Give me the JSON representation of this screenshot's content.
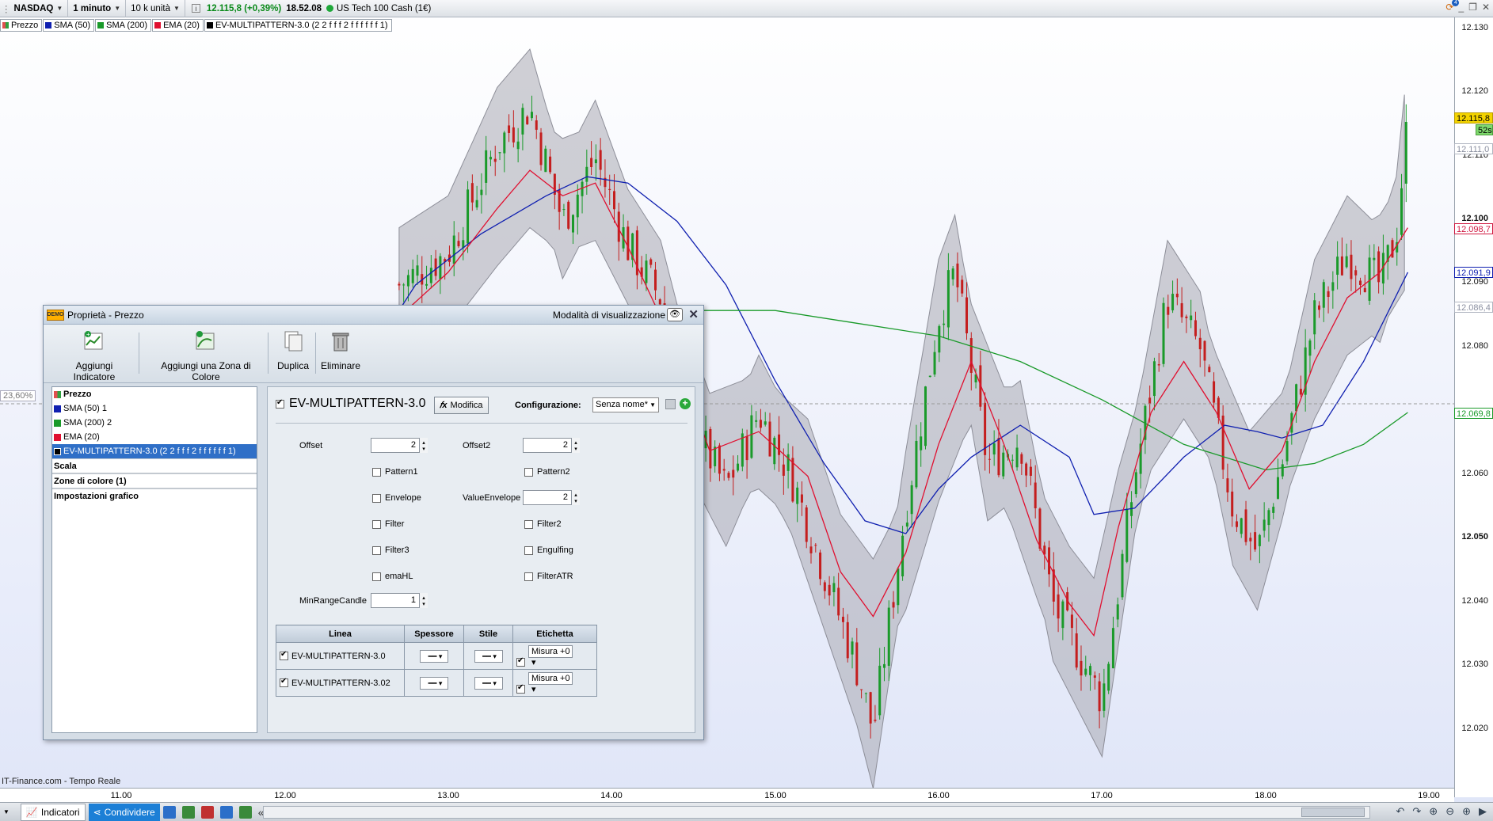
{
  "topbar": {
    "market": "NASDAQ",
    "interval": "1 minuto",
    "units": "10 k unità",
    "info_icon": "info-icon",
    "price_change": "12.115,8 (+0,39%)",
    "time": "18.52.08",
    "instrument": "US Tech 100 Cash (1€)",
    "notification_count": "4"
  },
  "legend": [
    {
      "label": "Prezzo",
      "color": "#e0505a"
    },
    {
      "label": "SMA (50)",
      "color": "#1020b0"
    },
    {
      "label": "SMA (200)",
      "color": "#1a9a2a"
    },
    {
      "label": "EMA (20)",
      "color": "#e01030"
    },
    {
      "label": "EV-MULTIPATTERN-3.0 (2 2 f f f 2 f f f f f f 1)",
      "color": "#000000"
    }
  ],
  "chart_data": {
    "type": "line",
    "title": "",
    "instrument": "US Tech 100 Cash (1€)",
    "ylim": [
      12015,
      12132
    ],
    "y_ticks": [
      "12.130",
      "12.120",
      "12.110",
      "12.100",
      "12.090",
      "12.080",
      "12.070",
      "12.060",
      "12.050",
      "12.040",
      "12.030",
      "12.020"
    ],
    "x_ticks": [
      "11.00",
      "12.00",
      "13.00",
      "14.00",
      "15.00",
      "16.00",
      "17.00",
      "18.00",
      "19.00"
    ],
    "series": [
      {
        "name": "SMA (50)",
        "color": "#1020b0",
        "x": [
          12.55,
          12.8,
          13.2,
          13.6,
          13.85,
          14.1,
          14.4,
          14.7,
          15.0,
          15.3,
          15.55,
          15.8,
          16.0,
          16.2,
          16.5,
          16.8,
          16.95,
          17.2,
          17.5,
          17.75,
          17.95,
          18.1,
          18.35,
          18.6,
          18.87
        ],
        "y": [
          12080,
          12090,
          12098,
          12104,
          12107,
          12106,
          12100,
          12090,
          12075,
          12062,
          12053,
          12051,
          12058,
          12063,
          12068,
          12063,
          12054,
          12055,
          12063,
          12068,
          12067,
          12066,
          12068,
          12078,
          12092
        ]
      },
      {
        "name": "SMA (200)",
        "color": "#1a9a2a",
        "x": [
          14.5,
          15.0,
          15.5,
          16.0,
          16.5,
          17.0,
          17.5,
          18.0,
          18.3,
          18.6,
          18.87
        ],
        "y": [
          12086,
          12086,
          12084,
          12082,
          12078,
          12072,
          12065,
          12061,
          12062,
          12065,
          12070
        ]
      },
      {
        "name": "EMA (20)",
        "color": "#e01030",
        "x": [
          12.7,
          13.0,
          13.3,
          13.5,
          13.7,
          13.9,
          14.1,
          14.3,
          14.6,
          14.9,
          15.2,
          15.4,
          15.6,
          15.8,
          16.0,
          16.2,
          16.4,
          16.6,
          16.8,
          16.95,
          17.1,
          17.3,
          17.5,
          17.7,
          17.9,
          18.1,
          18.3,
          18.5,
          18.7,
          18.87
        ],
        "y": [
          12085,
          12092,
          12102,
          12108,
          12104,
          12106,
          12096,
          12085,
          12064,
          12067,
          12060,
          12045,
          12038,
          12048,
          12065,
          12078,
          12065,
          12050,
          12040,
          12035,
          12052,
          12070,
          12078,
          12070,
          12058,
          12064,
          12078,
          12088,
          12092,
          12099
        ]
      },
      {
        "name": "Prezzo",
        "color": "#1a9a2a",
        "x": [
          12.7,
          13.0,
          13.3,
          13.5,
          13.7,
          13.9,
          14.1,
          14.3,
          14.5,
          14.7,
          14.9,
          15.1,
          15.3,
          15.5,
          15.6,
          15.8,
          16.0,
          16.1,
          16.3,
          16.5,
          16.7,
          16.9,
          17.0,
          17.2,
          17.4,
          17.6,
          17.8,
          17.95,
          18.1,
          18.3,
          18.5,
          18.7,
          18.8,
          18.87
        ],
        "y": [
          12090,
          12095,
          12112,
          12118,
          12100,
          12110,
          12096,
          12088,
          12068,
          12058,
          12070,
          12060,
          12045,
          12030,
          12020,
          12055,
          12085,
          12092,
          12062,
          12066,
          12040,
          12030,
          12025,
          12060,
          12088,
          12080,
          12055,
          12048,
          12062,
          12085,
          12095,
          12090,
          12098,
          12116
        ]
      }
    ],
    "envelope": {
      "label": "EV-MULTIPATTERN-3.0",
      "color": "#9a9aa3"
    }
  },
  "price_axis": {
    "labels": [
      {
        "text": "12.130",
        "bold": false
      },
      {
        "text": "12.120",
        "bold": false
      },
      {
        "text": "12.110",
        "bold": false
      },
      {
        "text": "12.100",
        "bold": true
      },
      {
        "text": "12.090",
        "bold": false
      },
      {
        "text": "12.080",
        "bold": false
      },
      {
        "text": "12.060",
        "bold": false
      },
      {
        "text": "12.050",
        "bold": true
      },
      {
        "text": "12.040",
        "bold": false
      },
      {
        "text": "12.030",
        "bold": false
      },
      {
        "text": "12.020",
        "bold": false
      }
    ],
    "tags": {
      "current": "12.115,8",
      "countdown": "52s",
      "t1": "12.111,0",
      "t2": "12.098,7",
      "t3": "12.091,9",
      "t4": "12.086,4",
      "t5": "12.069,8"
    },
    "fib": "23,60%"
  },
  "watermark": "IT-Finance.com - Tempo Reale",
  "time_axis": [
    "11.00",
    "12.00",
    "13.00",
    "14.00",
    "15.00",
    "16.00",
    "17.00",
    "18.00",
    "19.00"
  ],
  "bottombar": {
    "indicators": "Indicatori",
    "share": "Condividere"
  },
  "dialog": {
    "badge": "DEMO",
    "title": "Proprietà - Prezzo",
    "mode": "Modalità di visualizzazione",
    "toolbar": {
      "add_indicator": "Aggiungi Indicatore",
      "add_zone": "Aggiungi una Zona di Colore",
      "duplicate": "Duplica",
      "delete": "Eliminare"
    },
    "list": [
      {
        "label": "Prezzo",
        "color": "#e0505a",
        "bold": true
      },
      {
        "label": "SMA (50) 1",
        "color": "#1020b0"
      },
      {
        "label": "SMA (200) 2",
        "color": "#1a9a2a"
      },
      {
        "label": "EMA (20)",
        "color": "#e01030"
      },
      {
        "label": "EV-MULTIPATTERN-3.0 (2 2 f f f 2 f f f f f f 1)",
        "color": "#000000",
        "selected": true
      }
    ],
    "sections": [
      "Scala",
      "Zone di colore (1)",
      "Impostazioni grafico"
    ],
    "indicator_name": "EV-MULTIPATTERN-3.0",
    "modify": "Modifica",
    "config_label": "Configurazione:",
    "config_value": "Senza nome*",
    "params": {
      "offset_label": "Offset",
      "offset_value": "2",
      "offset2_label": "Offset2",
      "offset2_value": "2",
      "pattern1": "Pattern1",
      "pattern2": "Pattern2",
      "envelope": "Envelope",
      "value_envelope_label": "ValueEnvelope",
      "value_envelope_value": "2",
      "filter": "Filter",
      "filter2": "Filter2",
      "filter3": "Filter3",
      "engulfing": "Engulfing",
      "emahl": "emaHL",
      "filteratr": "FilterATR",
      "minrange_label": "MinRangeCandle",
      "minrange_value": "1"
    },
    "table": {
      "headers": [
        "Linea",
        "Spessore",
        "Stile",
        "Etichetta"
      ],
      "rows": [
        {
          "name": "EV-MULTIPATTERN-3.0",
          "label": "Misura +0"
        },
        {
          "name": "EV-MULTIPATTERN-3.02",
          "label": "Misura +0"
        }
      ]
    }
  }
}
